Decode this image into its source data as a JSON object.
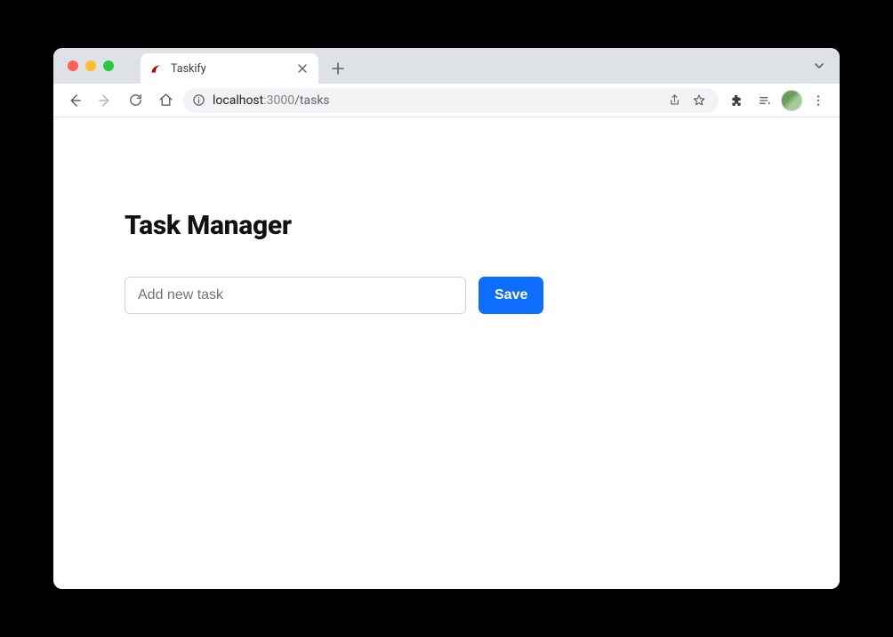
{
  "browser": {
    "tab_title": "Taskify",
    "url": {
      "host": "localhost",
      "port": ":3000",
      "path": "/tasks"
    }
  },
  "page": {
    "heading": "Task Manager",
    "input_placeholder": "Add new task",
    "save_label": "Save"
  }
}
